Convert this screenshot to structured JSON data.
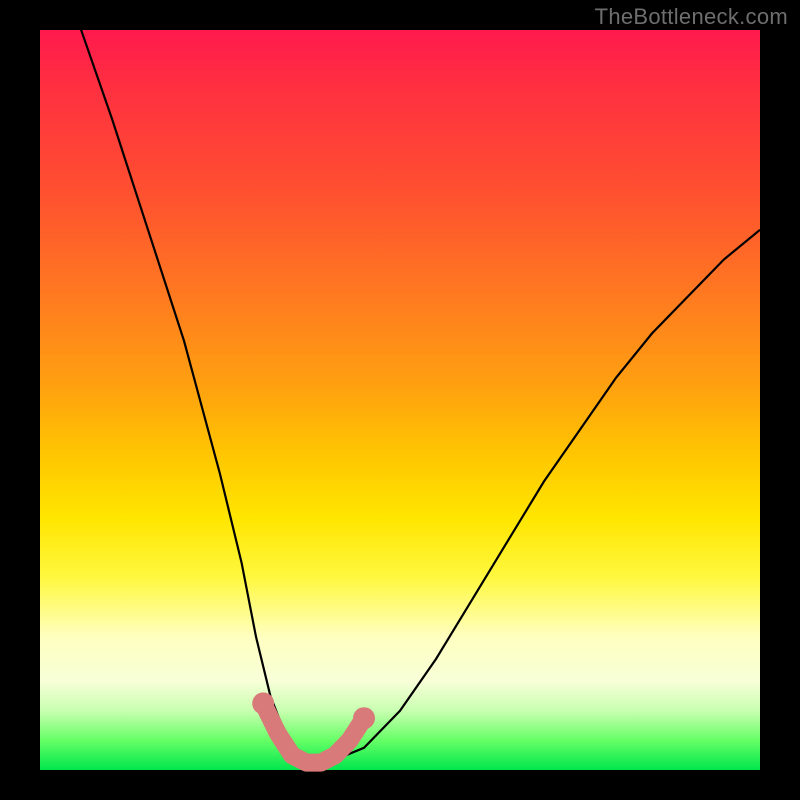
{
  "watermark": "TheBottleneck.com",
  "chart_data": {
    "type": "line",
    "title": "",
    "xlabel": "",
    "ylabel": "",
    "xlim": [
      0,
      100
    ],
    "ylim": [
      0,
      100
    ],
    "grid": false,
    "legend": null,
    "series": [
      {
        "name": "bottleneck-curve",
        "color": "#000000",
        "x": [
          5,
          10,
          15,
          20,
          25,
          28,
          30,
          32,
          34,
          36,
          38,
          40,
          45,
          50,
          55,
          60,
          65,
          70,
          75,
          80,
          85,
          90,
          95,
          100
        ],
        "y": [
          102,
          88,
          73,
          58,
          40,
          28,
          18,
          10,
          5,
          2,
          1,
          1,
          3,
          8,
          15,
          23,
          31,
          39,
          46,
          53,
          59,
          64,
          69,
          73
        ]
      },
      {
        "name": "highlight-trough",
        "color": "#d97a7a",
        "x": [
          31,
          33,
          35,
          37,
          39,
          41,
          43,
          45
        ],
        "y": [
          9,
          5,
          2,
          1,
          1,
          2,
          4,
          7
        ]
      }
    ]
  },
  "colors": {
    "frame": "#000000",
    "curve": "#000000",
    "highlight": "#d97a7a",
    "gradient_stops": [
      "#ff1a4d",
      "#ff7a20",
      "#ffe600",
      "#ffffc0",
      "#00e64d"
    ]
  }
}
